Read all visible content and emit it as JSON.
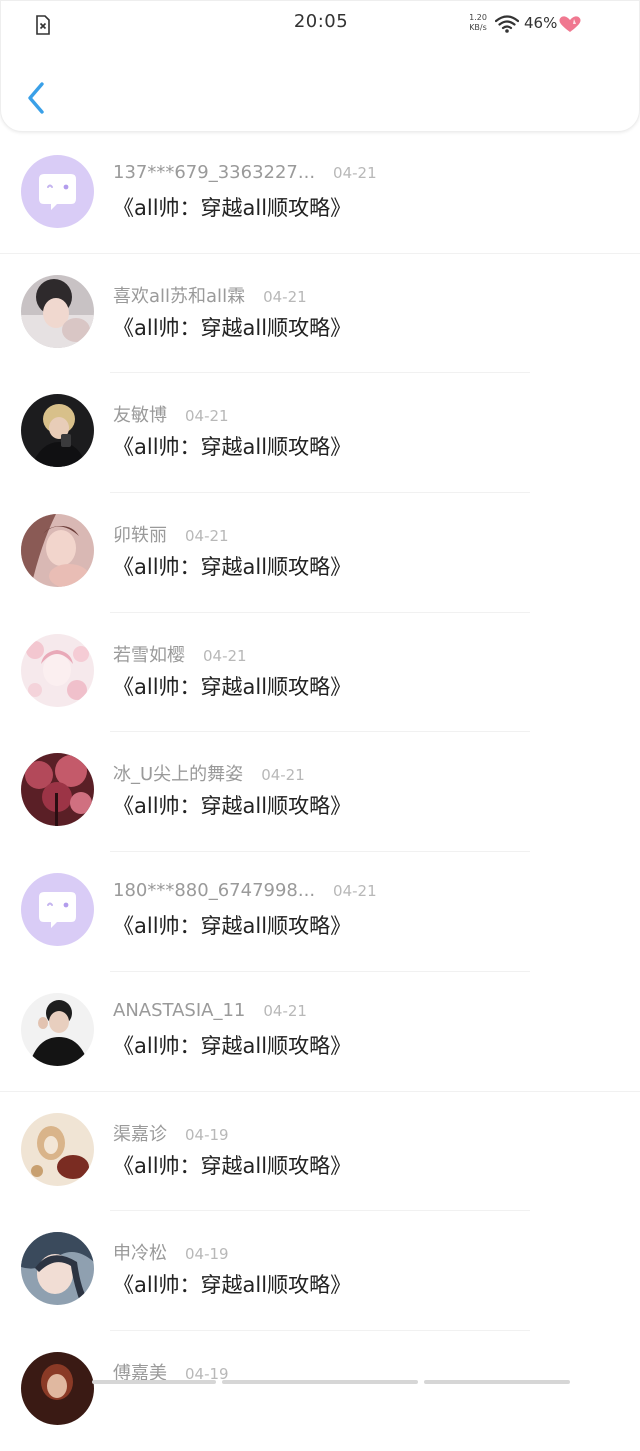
{
  "status_bar": {
    "time": "20:05",
    "net_speed_value": "1.20",
    "net_speed_unit": "KB/s",
    "battery": "46%"
  },
  "header": {
    "back_icon": "chevron-left-icon",
    "accent_color": "#3aa0e8"
  },
  "items": [
    {
      "name": "137***679_3363227...",
      "date": "04-21",
      "title": "《all帅：穿越all顺攻略》",
      "avatar": "default-chat-avatar"
    },
    {
      "name": "喜欢all苏和all霖",
      "date": "04-21",
      "title": "《all帅：穿越all顺攻略》",
      "avatar": "user-photo-avatar"
    },
    {
      "name": "友敏博",
      "date": "04-21",
      "title": "《all帅：穿越all顺攻略》",
      "avatar": "user-photo-avatar"
    },
    {
      "name": "卯轶丽",
      "date": "04-21",
      "title": "《all帅：穿越all顺攻略》",
      "avatar": "user-photo-avatar"
    },
    {
      "name": "若雪如樱",
      "date": "04-21",
      "title": "《all帅：穿越all顺攻略》",
      "avatar": "user-photo-avatar"
    },
    {
      "name": "冰_U尖上的舞姿",
      "date": "04-21",
      "title": "《all帅：穿越all顺攻略》",
      "avatar": "user-photo-avatar"
    },
    {
      "name": "180***880_6747998...",
      "date": "04-21",
      "title": "《all帅：穿越all顺攻略》",
      "avatar": "default-chat-avatar"
    },
    {
      "name": "ANASTASIA_11",
      "date": "04-21",
      "title": "《all帅：穿越all顺攻略》",
      "avatar": "user-photo-avatar"
    },
    {
      "name": "渠嘉诊",
      "date": "04-19",
      "title": "《all帅：穿越all顺攻略》",
      "avatar": "user-photo-avatar"
    },
    {
      "name": "申冷松",
      "date": "04-19",
      "title": "《all帅：穿越all顺攻略》",
      "avatar": "user-photo-avatar"
    },
    {
      "name": "傅嘉美",
      "date": "04-19",
      "title": "",
      "avatar": "user-photo-avatar"
    }
  ]
}
